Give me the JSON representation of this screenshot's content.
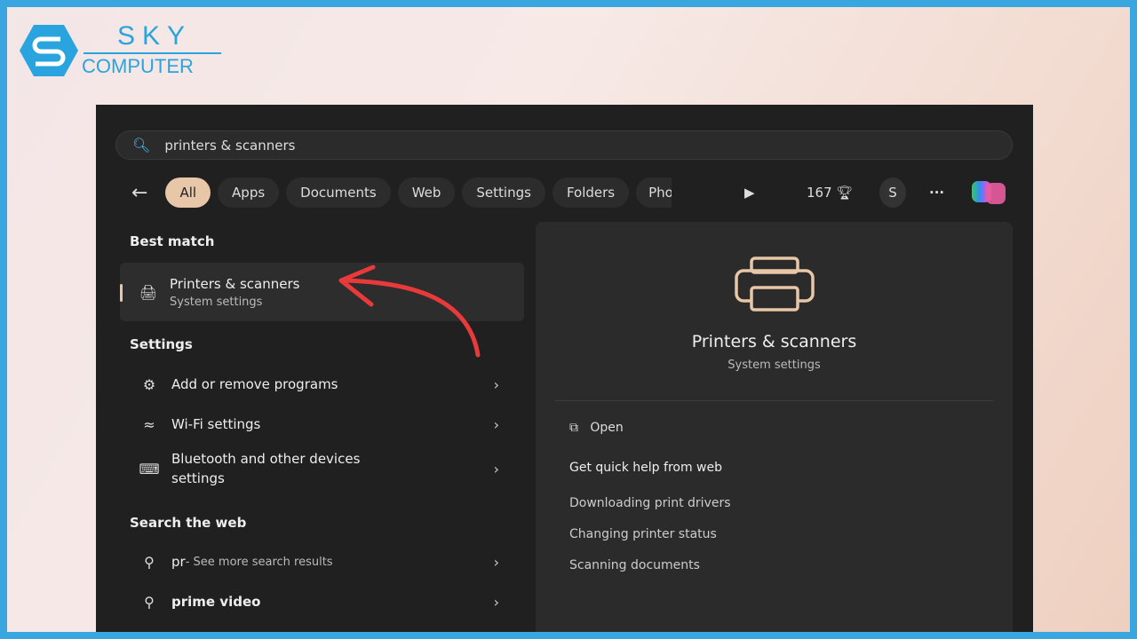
{
  "logo": {
    "top": "SKY",
    "bottom": "COMPUTER"
  },
  "search": {
    "value": "printers & scanners"
  },
  "filters": {
    "chips": [
      "All",
      "Apps",
      "Documents",
      "Web",
      "Settings",
      "Folders",
      "Pho"
    ],
    "points": "167",
    "avatar": "S",
    "more": "···"
  },
  "left": {
    "best_match": "Best match",
    "best": {
      "title": "Printers & scanners",
      "subtitle": "System settings"
    },
    "settings": "Settings",
    "settings_items": [
      "Add or remove programs",
      "Wi-Fi settings",
      "Bluetooth and other devices settings"
    ],
    "web": "Search the web",
    "web_items": [
      {
        "query": "pr",
        "suffix": " - See more search results"
      },
      {
        "query": "prime video",
        "suffix": ""
      }
    ]
  },
  "right": {
    "title": "Printers & scanners",
    "subtitle": "System settings",
    "open": "Open",
    "help": "Get quick help from web",
    "links": [
      "Downloading print drivers",
      "Changing printer status",
      "Scanning documents"
    ]
  },
  "colors": {
    "accent": "#e8c7a8",
    "frame": "#3aa6e0",
    "arrow": "#e83a3a"
  }
}
